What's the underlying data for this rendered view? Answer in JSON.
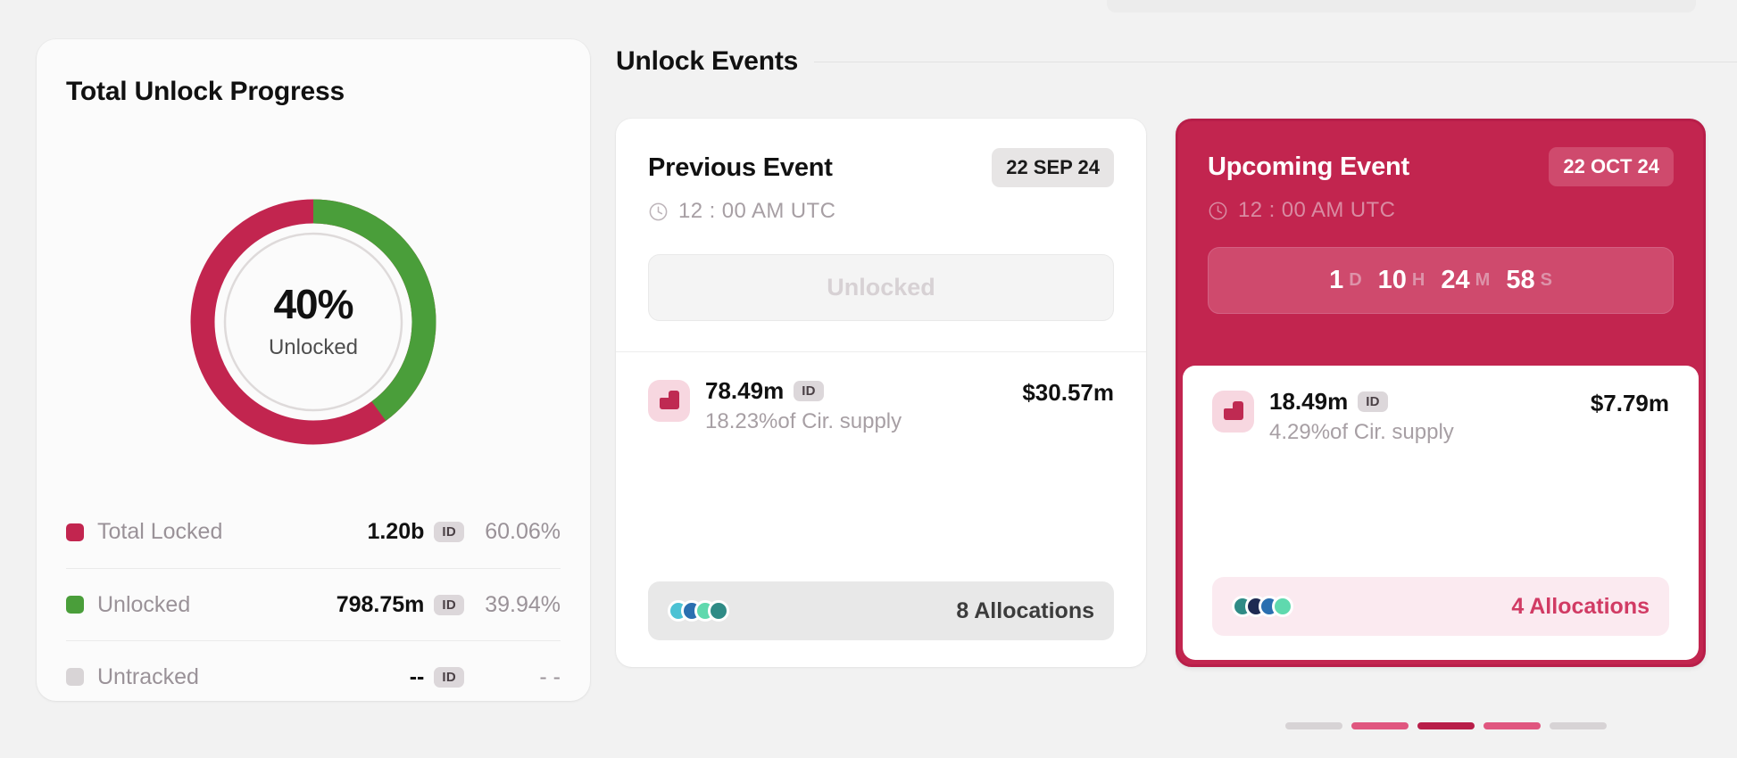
{
  "left_card": {
    "title": "Total Unlock Progress",
    "donut": {
      "percent_label": "40%",
      "sub_label": "Unlocked"
    },
    "legend": [
      {
        "label": "Total Locked",
        "value": "1.20b",
        "chip": "ID",
        "percent": "60.06%",
        "color": "#c2254f"
      },
      {
        "label": "Unlocked",
        "value": "798.75m",
        "chip": "ID",
        "percent": "39.94%",
        "color": "#4a9e3a"
      },
      {
        "label": "Untracked",
        "value": "--",
        "chip": "ID",
        "percent": "- -",
        "color": "#d8d4d6"
      }
    ]
  },
  "events": {
    "section_title": "Unlock Events",
    "previous": {
      "name": "Previous Event",
      "date": "22 SEP 24",
      "time": "12 : 00 AM UTC",
      "status": "Unlocked",
      "token_amount": "78.49m",
      "token_chip": "ID",
      "token_supply": "18.23%of Cir. supply",
      "token_usd": "$30.57m",
      "allocations": "8 Allocations",
      "dot_colors": [
        "#4cc2d4",
        "#2a6fb0",
        "#5fd9ae",
        "#2f8b86"
      ]
    },
    "upcoming": {
      "name": "Upcoming Event",
      "date": "22 OCT 24",
      "time": "12 : 00 AM UTC",
      "countdown": {
        "days": "1",
        "days_unit": "D",
        "hours": "10",
        "hours_unit": "H",
        "minutes": "24",
        "minutes_unit": "M",
        "seconds": "58",
        "seconds_unit": "S"
      },
      "token_amount": "18.49m",
      "token_chip": "ID",
      "token_supply": "4.29%of Cir. supply",
      "token_usd": "$7.79m",
      "allocations": "4 Allocations",
      "dot_colors": [
        "#2f8b86",
        "#1e2a52",
        "#2a6fb0",
        "#5fd9ae"
      ]
    }
  },
  "pagination": [
    {
      "color": "#d7d3d5"
    },
    {
      "color": "#e0567f"
    },
    {
      "color": "#b81e49"
    },
    {
      "color": "#e0567f"
    },
    {
      "color": "#d7d3d5"
    }
  ],
  "chart_data": {
    "type": "pie",
    "title": "Total Unlock Progress",
    "categories": [
      "Total Locked",
      "Unlocked",
      "Untracked"
    ],
    "values": [
      60.06,
      39.94,
      0
    ],
    "value_labels": [
      "1.20b",
      "798.75m",
      "--"
    ],
    "colors": [
      "#c2254f",
      "#4a9e3a",
      "#d8d4d6"
    ],
    "center_label": "40%",
    "center_sublabel": "Unlocked",
    "legend_position": "bottom",
    "units": "percent of total supply"
  }
}
